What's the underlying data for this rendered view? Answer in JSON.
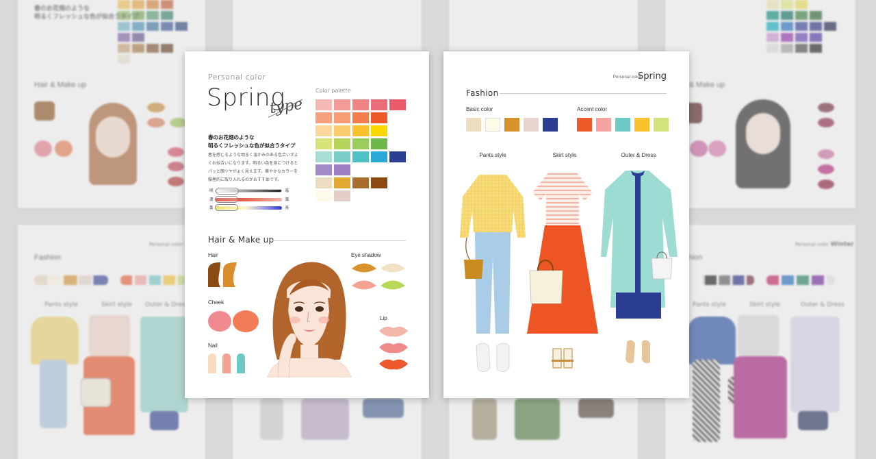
{
  "left_card": {
    "personal_color_label": "Personal color",
    "season_title": "Spring",
    "type_script": "type",
    "headline_line1": "春のお花畑のような",
    "headline_line2": "明るくフレッシュな色が似合うタイプ",
    "description": "春を感じるような明るく温かみのある色合いがよくお似合いになります。明るい色を身につけるとパッと顔ツヤがよく見えます。華やかなカラーを積極的に取り入れるのがおすすめです。",
    "scale": [
      {
        "left": "明",
        "right": "暗",
        "colors": [
          "#ffffff",
          "#222222"
        ]
      },
      {
        "left": "濃",
        "right": "薄",
        "colors": [
          "#c7362e",
          "#f4b5a8"
        ]
      },
      {
        "left": "黄",
        "right": "青",
        "colors": [
          "#e9d93a",
          "#2b3ad6"
        ]
      }
    ],
    "color_palette_label": "Color palette",
    "palette": [
      "#f7b9b5",
      "#f49b99",
      "#f08483",
      "#ec6d7a",
      "#e95a6a",
      "#f6a07f",
      "#f79c74",
      "#f37f4f",
      "#ef5a2b",
      "",
      "#fbd79b",
      "#fbcb6d",
      "#fbc22e",
      "#fbd800",
      "",
      "#d8e37a",
      "#b5d55a",
      "#9ccc5b",
      "#6db84a",
      "",
      "#a7ddd4",
      "#79cdc8",
      "#4ec1c6",
      "#2aa9d6",
      "#2c3e94",
      "#a48ac7",
      "#9c7fc0",
      "",
      "",
      "",
      "#ecdcc0",
      "#e2a832",
      "#a86d2f",
      "#8a4a12",
      "",
      "#fefae8",
      "#e3cfc8",
      "",
      "",
      ""
    ],
    "hair_makeup_title": "Hair & Make up",
    "hair_label": "Hair",
    "hair_colors": [
      "#8a4a12",
      "#d98d2e"
    ],
    "cheek_label": "Cheek",
    "cheek_colors": [
      "#f08a90",
      "#f27c55"
    ],
    "nail_label": "Nail",
    "nail_colors": [
      "#f7dcc0",
      "#f4a393",
      "#6ecac6"
    ],
    "eye_shadow_label": "Eye shadow",
    "eye_shadow_colors": [
      "#d9922b",
      "#f3e1c4",
      "#f4a393",
      "#b7d857"
    ],
    "lip_label": "Lip",
    "lip_colors": [
      "#f4b5ab",
      "#ee8b88",
      "#ee5a2e"
    ]
  },
  "right_card": {
    "personal_color_label": "Personal color",
    "season_title": "Spring",
    "fashion_title": "Fashion",
    "basic_color_label": "Basic color",
    "basic_colors": [
      "#ecdcc0",
      "#fefae8",
      "#d9922b",
      "#e7d6cf",
      "#2c3e94"
    ],
    "accent_color_label": "Accent color",
    "accent_colors": [
      "#ef5a2b",
      "#f4a3a0",
      "#6ecac6",
      "#fbc22e",
      "#d4e27c"
    ],
    "pants_style_label": "Pants style",
    "skirt_style_label": "Skirt style",
    "outer_dress_label": "Outer & Dress"
  }
}
